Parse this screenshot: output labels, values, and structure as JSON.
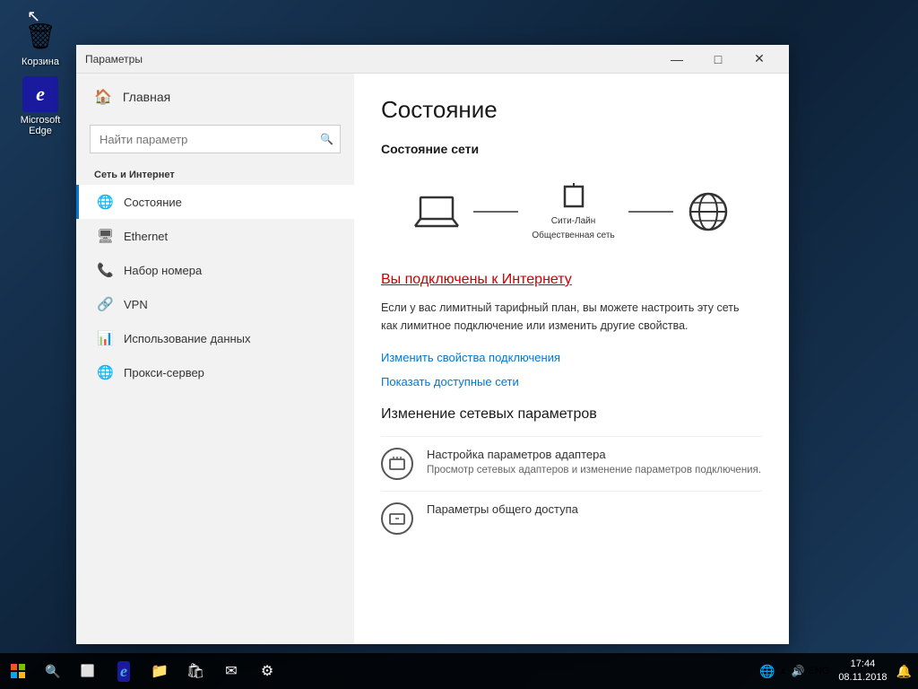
{
  "desktop": {
    "icons": [
      {
        "id": "recycle-bin",
        "label": "Корзина",
        "symbol": "🗑"
      },
      {
        "id": "edge",
        "label": "Microsoft Edge",
        "symbol": "🌐"
      }
    ]
  },
  "taskbar": {
    "start_label": "Start",
    "search_label": "Search",
    "tray": {
      "network": "🌐",
      "volume": "🔊",
      "language": "ENG",
      "clock_time": "17:44",
      "clock_date": "08.11.2018",
      "notification": "🔔"
    }
  },
  "window": {
    "title": "Параметры",
    "controls": {
      "minimize": "—",
      "maximize": "□",
      "close": "✕"
    }
  },
  "sidebar": {
    "home_label": "Главная",
    "search_placeholder": "Найти параметр",
    "section_title": "Сеть и Интернет",
    "items": [
      {
        "id": "status",
        "label": "Состояние",
        "active": true
      },
      {
        "id": "ethernet",
        "label": "Ethernet",
        "active": false
      },
      {
        "id": "dial-up",
        "label": "Набор номера",
        "active": false
      },
      {
        "id": "vpn",
        "label": "VPN",
        "active": false
      },
      {
        "id": "data-usage",
        "label": "Использование данных",
        "active": false
      },
      {
        "id": "proxy",
        "label": "Прокси-сервер",
        "active": false
      }
    ]
  },
  "main": {
    "title": "Состояние",
    "network_status_heading": "Состояние сети",
    "network_name": "Сити-Лайн",
    "network_type": "Общественная сеть",
    "connected_text": "Вы подключены к Интернету",
    "description": "Если у вас лимитный тарифный план, вы можете настроить эту сеть как лимитное подключение или изменить другие свойства.",
    "link1": "Изменить свойства подключения",
    "link2": "Показать доступные сети",
    "change_section_title": "Изменение сетевых параметров",
    "settings_items": [
      {
        "id": "adapter",
        "title": "Настройка параметров адаптера",
        "desc": "Просмотр сетевых адаптеров и изменение параметров подключения."
      },
      {
        "id": "sharing",
        "title": "Параметры общего доступа",
        "desc": ""
      }
    ]
  }
}
